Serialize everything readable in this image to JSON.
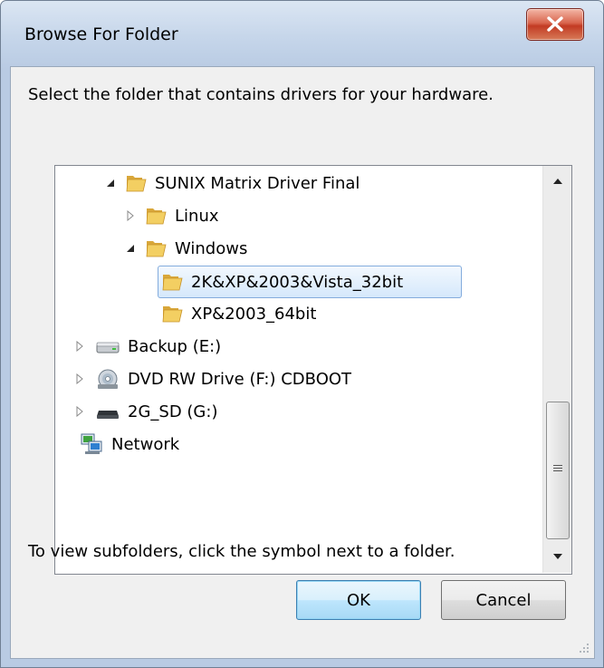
{
  "window": {
    "title": "Browse For Folder",
    "close_icon": "close-icon"
  },
  "dialog": {
    "instruction": "Select the folder that contains drivers for your hardware.",
    "hint": "To view subfolders, click the symbol next to a folder.",
    "ok_label": "OK",
    "cancel_label": "Cancel"
  },
  "tree": {
    "items": [
      {
        "label": "SUNIX Matrix Driver Final",
        "icon": "folder-icon",
        "expander": "expanded"
      },
      {
        "label": "Linux",
        "icon": "folder-icon",
        "expander": "collapsed"
      },
      {
        "label": "Windows",
        "icon": "folder-icon",
        "expander": "expanded"
      },
      {
        "label": "2K&XP&2003&Vista_32bit",
        "icon": "folder-icon",
        "expander": "none",
        "selected": true
      },
      {
        "label": "XP&2003_64bit",
        "icon": "folder-icon",
        "expander": "none"
      },
      {
        "label": "Backup (E:)",
        "icon": "hard-drive-icon",
        "expander": "collapsed"
      },
      {
        "label": "DVD RW Drive (F:) CDBOOT",
        "icon": "dvd-drive-icon",
        "expander": "collapsed"
      },
      {
        "label": "2G_SD (G:)",
        "icon": "removable-drive-icon",
        "expander": "collapsed"
      },
      {
        "label": "Network",
        "icon": "network-icon",
        "expander": "none"
      }
    ]
  },
  "colors": {
    "selection": "#d5e8fb",
    "close_button": "#c23b23",
    "default_button": "#3c7fb1"
  }
}
